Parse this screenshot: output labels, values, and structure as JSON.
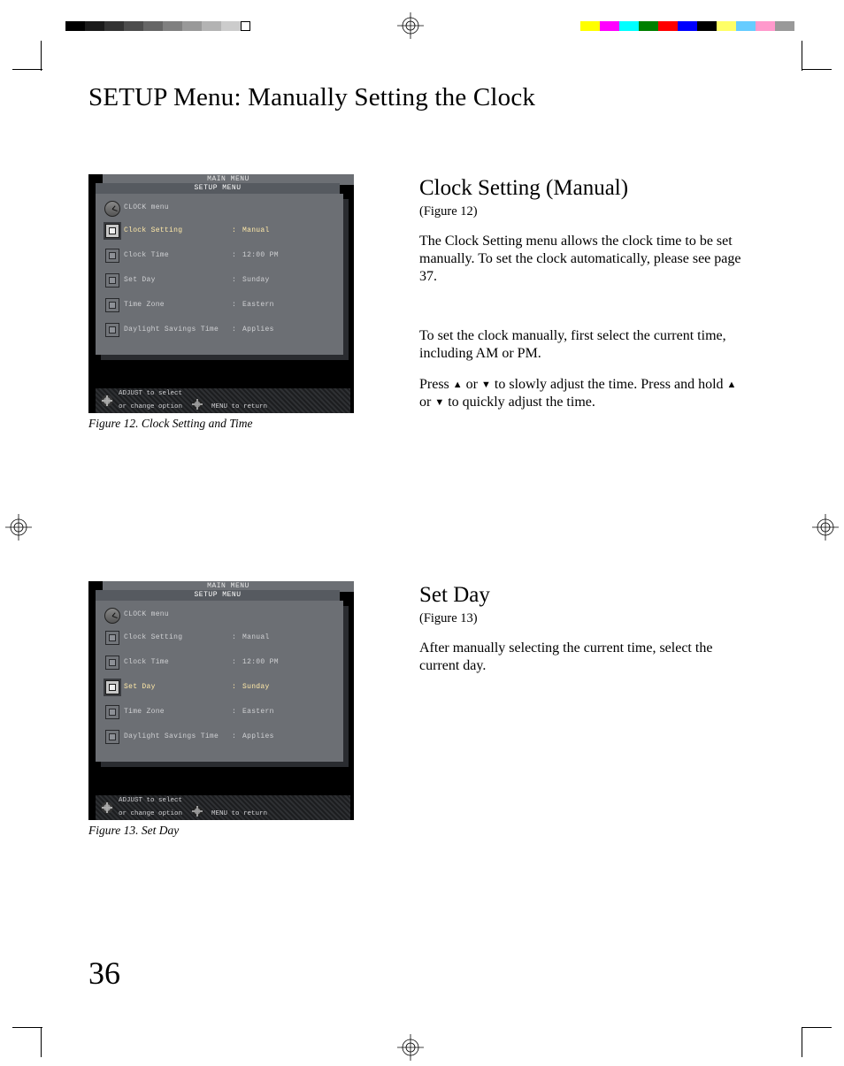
{
  "page_title": "SETUP Menu: Manually Setting the Clock",
  "page_number": "36",
  "colorbar_left": [
    "#000000",
    "#1a1a1a",
    "#333333",
    "#4d4d4d",
    "#666666",
    "#808080",
    "#999999",
    "#b3b3b3",
    "#cccccc"
  ],
  "colorbar_right": [
    "#ffff00",
    "#ff00ff",
    "#00ffff",
    "#008000",
    "#ff0000",
    "#0000ff",
    "#000000",
    "#ffff66",
    "#66ccff",
    "#ff99cc",
    "#999999"
  ],
  "section1": {
    "heading": "Clock Setting (Manual)",
    "figref": "(Figure 12)",
    "p1": "The Clock Setting menu allows the clock time to be set manually.  To set the clock automatically, please see page 37.",
    "p2": "To set the clock manually, first select the current time, including AM or PM.",
    "p3a": "Press ",
    "p3b": " or  ",
    "p3c": " to slowly adjust the time.  Press and hold ",
    "p3d": " or ",
    "p3e": " to quickly adjust the time."
  },
  "section2": {
    "heading": "Set Day",
    "figref": "(Figure 13)",
    "p1": "After manually selecting the current time, select the current day."
  },
  "menu": {
    "main_label": "MAIN MENU",
    "setup_label": "SETUP MENU",
    "header_label": "CLOCK menu",
    "rows": [
      {
        "label": "Clock Setting",
        "value": "Manual"
      },
      {
        "label": "Clock Time",
        "value": "12:00 PM"
      },
      {
        "label": "Set Day",
        "value": "Sunday"
      },
      {
        "label": "Time Zone",
        "value": "Eastern"
      },
      {
        "label": "Daylight Savings Time",
        "value": "Applies"
      }
    ],
    "hint_line1": "ADJUST to select",
    "hint_line2a": "or change option",
    "hint_line2b": "MENU to return"
  },
  "fig12_selected_index": 0,
  "fig13_selected_index": 2,
  "caption12": "Figure 12.  Clock Setting and Time",
  "caption13": "Figure 13.  Set Day"
}
